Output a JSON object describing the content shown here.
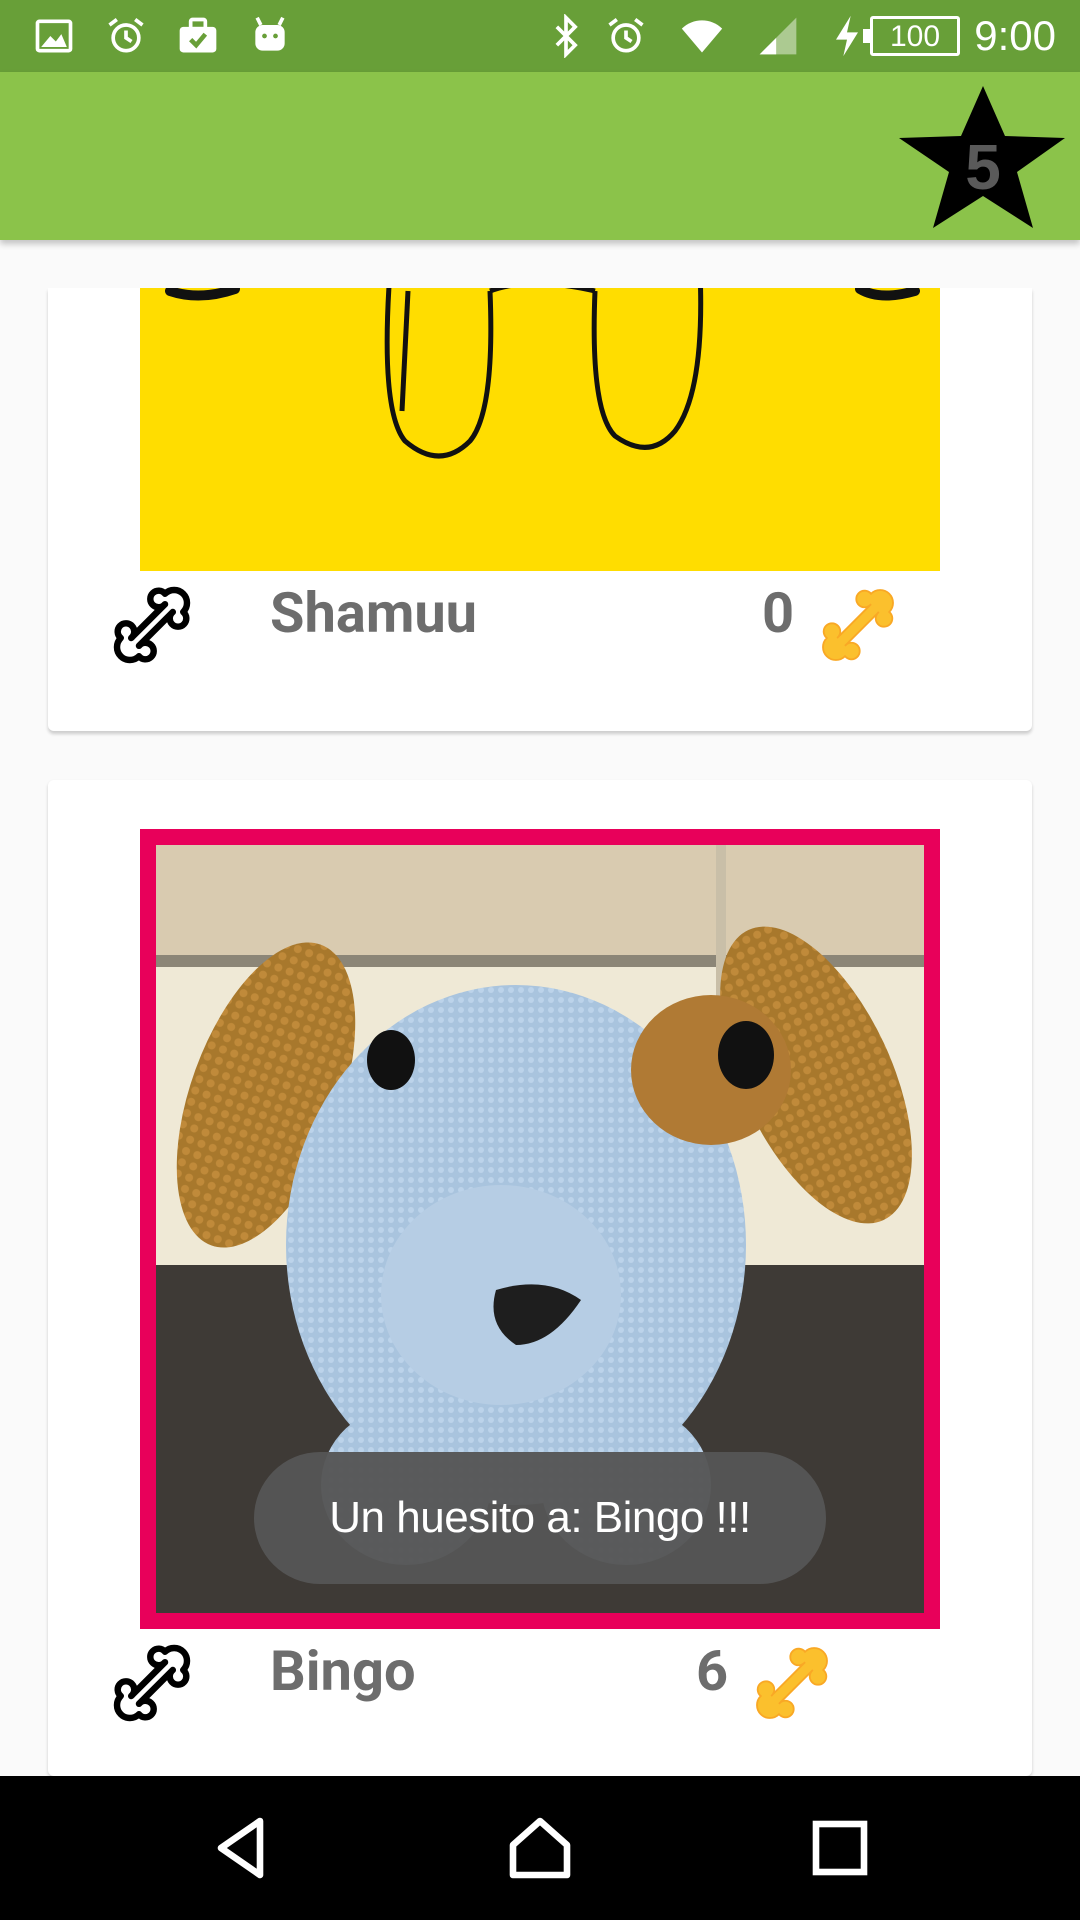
{
  "status_bar": {
    "time": "9:00",
    "battery": "100",
    "left_icons": [
      "gallery-icon",
      "alarm-icon",
      "briefcase-check-icon",
      "android-icon"
    ],
    "right_icons": [
      "bluetooth-icon",
      "alarm-icon",
      "wifi-icon",
      "signal-icon",
      "charging-icon",
      "battery-icon"
    ],
    "color": "#689f38"
  },
  "app_bar": {
    "color": "#8bc34a",
    "star_count": "5"
  },
  "pets": [
    {
      "name": "Shamuu",
      "bones": "0",
      "photo": "yellow-cartoon-photo"
    },
    {
      "name": "Bingo",
      "bones": "6",
      "photo": "crochet-dog-photo"
    }
  ],
  "toast": {
    "message": "Un huesito a: Bingo  !!!"
  },
  "nav_bar": {
    "buttons": [
      "back-icon",
      "home-icon",
      "recents-icon"
    ]
  }
}
